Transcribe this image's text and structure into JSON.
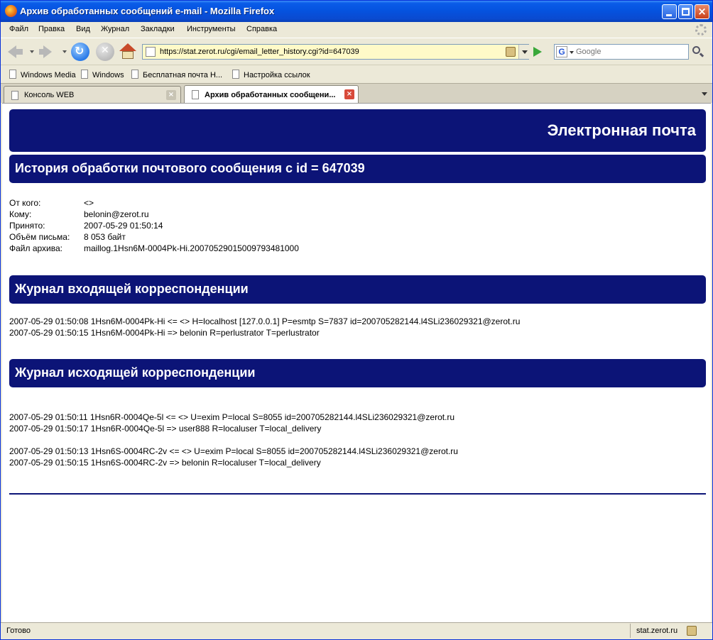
{
  "window": {
    "title": "Архив обработанных сообщений e-mail - Mozilla Firefox"
  },
  "menu": [
    "Файл",
    "Правка",
    "Вид",
    "Журнал",
    "Закладки",
    "Инструменты",
    "Справка"
  ],
  "toolbar": {
    "url": "https://stat.zerot.ru/cgi/email_letter_history.cgi?id=647039",
    "search_placeholder": "Google",
    "search_engine": "G"
  },
  "bookmarks": [
    "Windows Media",
    "Windows",
    "Бесплатная почта Н...",
    "Настройка ссылок"
  ],
  "tabs": [
    {
      "label": "Консоль WEB",
      "active": false
    },
    {
      "label": "Архив обработанных сообщени...",
      "active": true
    }
  ],
  "page": {
    "banner": "Электронная почта",
    "history_title": "История обработки почтового сообщения с id = 647039",
    "meta": [
      {
        "label": "От кого:",
        "value": "<>"
      },
      {
        "label": "Кому:",
        "value": "belonin@zerot.ru"
      },
      {
        "label": "Принято:",
        "value": "2007-05-29 01:50:14"
      },
      {
        "label": "Объём письма:",
        "value": "8 053 байт"
      },
      {
        "label": "Файл архива:",
        "value": "maillog.1Hsn6M-0004Pk-Hi.20070529015009793481000"
      }
    ],
    "incoming_title": "Журнал входящей корреспонденции",
    "incoming_log": [
      "2007-05-29 01:50:08 1Hsn6M-0004Pk-Hi <= <> H=localhost [127.0.0.1] P=esmtp S=7837 id=200705282144.l4SLi236029321@zerot.ru",
      "2007-05-29 01:50:15 1Hsn6M-0004Pk-Hi => belonin R=perlustrator T=perlustrator"
    ],
    "outgoing_title": "Журнал исходящей корреспонденции",
    "outgoing_log": [
      "2007-05-29 01:50:11 1Hsn6R-0004Qe-5l <= <> U=exim P=local S=8055 id=200705282144.l4SLi236029321@zerot.ru",
      "2007-05-29 01:50:17 1Hsn6R-0004Qe-5l => user888 R=localuser T=local_delivery",
      "2007-05-29 01:50:13 1Hsn6S-0004RC-2v <= <> U=exim P=local S=8055 id=200705282144.l4SLi236029321@zerot.ru",
      "2007-05-29 01:50:15 1Hsn6S-0004RC-2v => belonin R=localuser T=local_delivery"
    ]
  },
  "status": {
    "text": "Готово",
    "host": "stat.zerot.ru"
  },
  "colors": {
    "banner": "#0c1477",
    "titlebar": "#0553e0"
  }
}
